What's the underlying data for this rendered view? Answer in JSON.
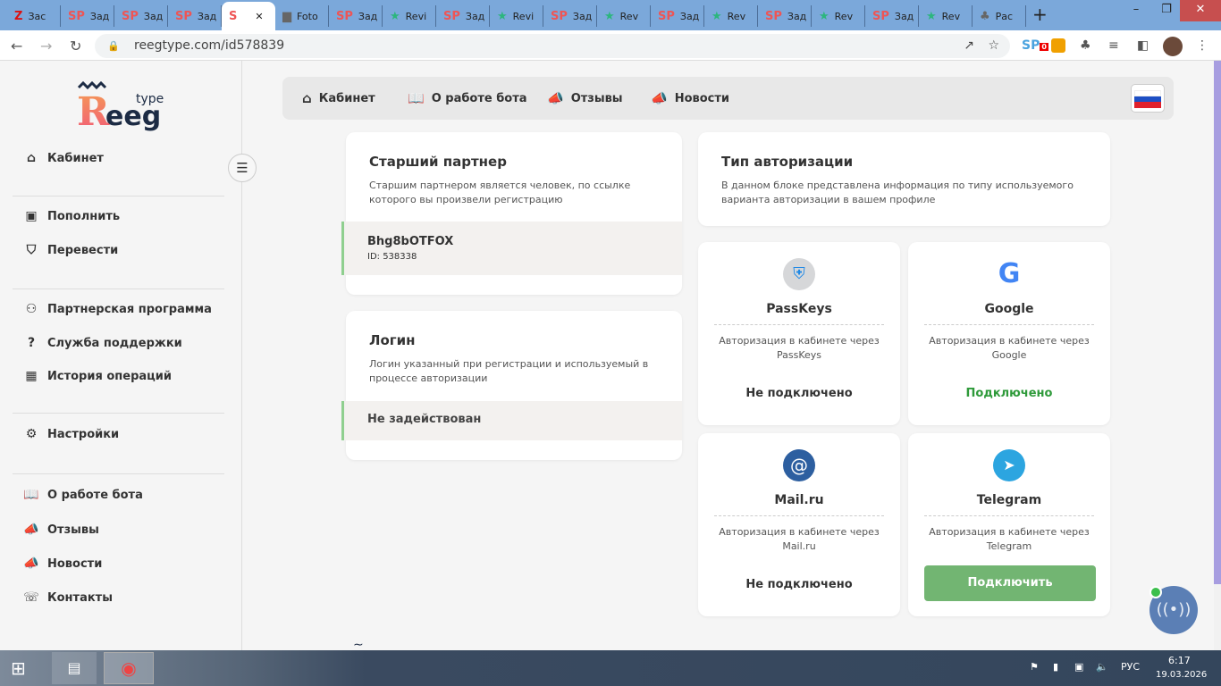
{
  "browser": {
    "tabs": [
      {
        "icon": "Z",
        "label": "Зас"
      },
      {
        "icon": "SP",
        "label": "Зад"
      },
      {
        "icon": "SP",
        "label": "Зад"
      },
      {
        "icon": "SP",
        "label": "Зад"
      },
      {
        "icon": "S",
        "label": ""
      },
      {
        "icon": "photo",
        "label": "Foto"
      },
      {
        "icon": "SP",
        "label": "Зад"
      },
      {
        "icon": "★",
        "label": "Revi"
      },
      {
        "icon": "SP",
        "label": "Зад"
      },
      {
        "icon": "★",
        "label": "Revi"
      },
      {
        "icon": "SP",
        "label": "Зад"
      },
      {
        "icon": "★",
        "label": "Rev"
      },
      {
        "icon": "SP",
        "label": "Зад"
      },
      {
        "icon": "★",
        "label": "Rev"
      },
      {
        "icon": "SP",
        "label": "Зад"
      },
      {
        "icon": "★",
        "label": "Rev"
      },
      {
        "icon": "SP",
        "label": "Зад"
      },
      {
        "icon": "★",
        "label": "Rev"
      },
      {
        "icon": "puzzle",
        "label": "Рас"
      }
    ],
    "url": "reegtype.com/id578839",
    "ext_badge": "0"
  },
  "logo": {
    "main": "Reeg",
    "sup": "type"
  },
  "sidebar": {
    "items": [
      {
        "label": "Кабинет",
        "icon": "home-icon"
      },
      {
        "label": "Пополнить",
        "icon": "wallet-icon"
      },
      {
        "label": "Перевести",
        "icon": "transfer-icon"
      },
      {
        "label": "Партнерская программа",
        "icon": "users-icon"
      },
      {
        "label": "Служба поддержки",
        "icon": "help-icon"
      },
      {
        "label": "История операций",
        "icon": "calendar-icon"
      },
      {
        "label": "Настройки",
        "icon": "gear-icon"
      },
      {
        "label": "О работе бота",
        "icon": "book-icon"
      },
      {
        "label": "Отзывы",
        "icon": "megaphone-icon"
      },
      {
        "label": "Новости",
        "icon": "megaphone-icon"
      },
      {
        "label": "Контакты",
        "icon": "contact-icon"
      }
    ]
  },
  "topnav": {
    "items": [
      {
        "label": "Кабинет"
      },
      {
        "label": "О работе бота"
      },
      {
        "label": "Отзывы"
      },
      {
        "label": "Новости"
      }
    ],
    "language": "ru"
  },
  "partner": {
    "title": "Старший партнер",
    "desc": "Старшим партнером является человек, по ссылке которого вы произвели регистрацию",
    "name": "Bhg8bOTFOX",
    "id": "ID: 538338"
  },
  "login": {
    "title": "Логин",
    "desc": "Логин указанный при регистрации и используемый в процессе авторизации",
    "value": "Не задействован"
  },
  "auth": {
    "title": "Тип авторизации",
    "desc": "В данном блоке представлена информация по типу используемого варианта авторизации в вашем профиле",
    "methods": [
      {
        "name": "PassKeys",
        "desc": "Авторизация в кабинете через PassKeys",
        "status": "Не подключено"
      },
      {
        "name": "Google",
        "desc": "Авторизация в кабинете через Google",
        "status": "Подключено"
      },
      {
        "name": "Mail.ru",
        "desc": "Авторизация в кабинете через Mail.ru",
        "status": "Не подключено"
      },
      {
        "name": "Telegram",
        "desc": "Авторизация в кабинете через Telegram",
        "button": "Подключить"
      }
    ]
  },
  "colors": {
    "accent": "#72b572",
    "connected": "#2e9a3a",
    "fab": "#5b7fb5"
  },
  "taskbar": {
    "lang": "РУС",
    "time": "6:17",
    "date": "19.03.2026"
  }
}
